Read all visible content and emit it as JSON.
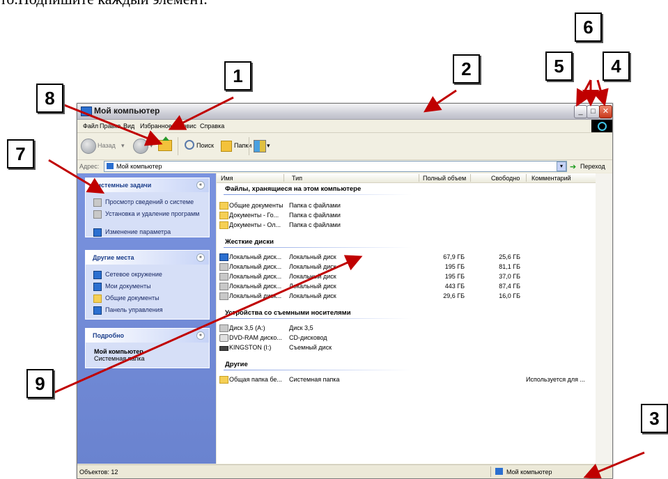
{
  "instruction_text": "то.Подпишите каждый элемент.",
  "window": {
    "title": "Мой компьютер",
    "minimize_symbol": "_",
    "maximize_symbol": "□",
    "close_symbol": "✕"
  },
  "menu": [
    "Файл",
    "Правка",
    "Вид",
    "Избранное",
    "Сервис",
    "Справка"
  ],
  "toolbar": {
    "back_label": "Назад",
    "search_label": "Поиск",
    "folders_label": "Папки",
    "dropdown_symbol": "▾"
  },
  "address": {
    "label": "Адрес:",
    "value": "Мой компьютер",
    "dropdown_symbol": "▾",
    "go_arrow": "➔",
    "go_label": "Переход"
  },
  "left_panels": [
    {
      "header": "Системные задачи",
      "collapse_symbol": "«",
      "items": [
        {
          "label": "Просмотр сведений о системе",
          "icon": "system-info-icon"
        },
        {
          "label": "Установка и удаление программ",
          "icon": "install-remove-icon"
        },
        {
          "label": "Изменение параметра",
          "icon": "settings-icon"
        }
      ]
    },
    {
      "header": "Другие места",
      "collapse_symbol": "«",
      "items": [
        {
          "label": "Сетевое окружение",
          "icon": "network-icon"
        },
        {
          "label": "Мои документы",
          "icon": "documents-icon"
        },
        {
          "label": "Общие документы",
          "icon": "folder-icon"
        },
        {
          "label": "Панель управления",
          "icon": "control-panel-icon"
        }
      ]
    },
    {
      "header": "Подробно",
      "collapse_symbol": "«",
      "details_title": "Мой компьютер",
      "details_sub": "Системная папка"
    }
  ],
  "columns": [
    "Имя",
    "Тип",
    "Полный объем",
    "Свободно",
    "Комментарий"
  ],
  "groups": [
    {
      "title": "Файлы, хранящиеся на этом компьютере",
      "rows": [
        {
          "name": "Общие документы",
          "type": "Папка с файлами",
          "total": "",
          "free": "",
          "comment": "",
          "icon": "folder-icon"
        },
        {
          "name": "Документы - Го...",
          "type": "Папка с файлами",
          "total": "",
          "free": "",
          "comment": "",
          "icon": "folder-icon"
        },
        {
          "name": "Документы - Ол...",
          "type": "Папка с файлами",
          "total": "",
          "free": "",
          "comment": "",
          "icon": "folder-icon"
        }
      ]
    },
    {
      "title": "Жесткие диски",
      "rows": [
        {
          "name": "Локальный диск...",
          "type": "Локальный диск",
          "total": "67,9 ГБ",
          "free": "25,6 ГБ",
          "comment": "",
          "icon": "system-drive-icon"
        },
        {
          "name": "Локальный диск...",
          "type": "Локальный диск",
          "total": "195 ГБ",
          "free": "81,1 ГБ",
          "comment": "",
          "icon": "hard-drive-icon"
        },
        {
          "name": "Локальный диск...",
          "type": "Локальный диск",
          "total": "195 ГБ",
          "free": "37,0 ГБ",
          "comment": "",
          "icon": "hard-drive-icon"
        },
        {
          "name": "Локальный диск...",
          "type": "Локальный диск",
          "total": "443 ГБ",
          "free": "87,4 ГБ",
          "comment": "",
          "icon": "hard-drive-icon"
        },
        {
          "name": "Локальный диск...",
          "type": "Локальный диск",
          "total": "29,6 ГБ",
          "free": "16,0 ГБ",
          "comment": "",
          "icon": "hard-drive-icon"
        }
      ]
    },
    {
      "title": "Устройства со съемными носителями",
      "rows": [
        {
          "name": "Диск 3,5 (A:)",
          "type": "Диск 3,5",
          "total": "",
          "free": "",
          "comment": "",
          "icon": "floppy-icon"
        },
        {
          "name": "DVD-RAM диско...",
          "type": "CD-дисковод",
          "total": "",
          "free": "",
          "comment": "",
          "icon": "dvd-drive-icon"
        },
        {
          "name": "KINGSTON (I:)",
          "type": "Съемный диск",
          "total": "",
          "free": "",
          "comment": "",
          "icon": "usb-drive-icon"
        }
      ]
    },
    {
      "title": "Другие",
      "rows": [
        {
          "name": "Общая папка бе...",
          "type": "Системная папка",
          "total": "",
          "free": "",
          "comment": "Используется для ...",
          "icon": "shared-folder-icon"
        }
      ]
    }
  ],
  "status": {
    "objects": "Объектов: 12",
    "location": "Мой компьютер"
  },
  "callouts": [
    "1",
    "2",
    "3",
    "4",
    "5",
    "6",
    "7",
    "8",
    "9"
  ],
  "colors": {
    "taskpane_blue": "#7a93df",
    "callout_arrow": "#c00000",
    "window_chrome": "#ece9d8"
  }
}
